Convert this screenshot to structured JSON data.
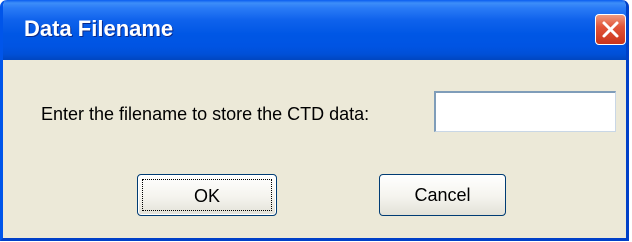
{
  "dialog": {
    "title": "Data Filename",
    "prompt": "Enter the filename to store the CTD data:",
    "filename_value": "",
    "ok_label": "OK",
    "cancel_label": "Cancel"
  },
  "icons": {
    "close": "close-icon"
  },
  "colors": {
    "titlebar": "#0054e3",
    "dialog_background": "#ece9d8",
    "close_button": "#e2553a",
    "button_border": "#003c74"
  }
}
